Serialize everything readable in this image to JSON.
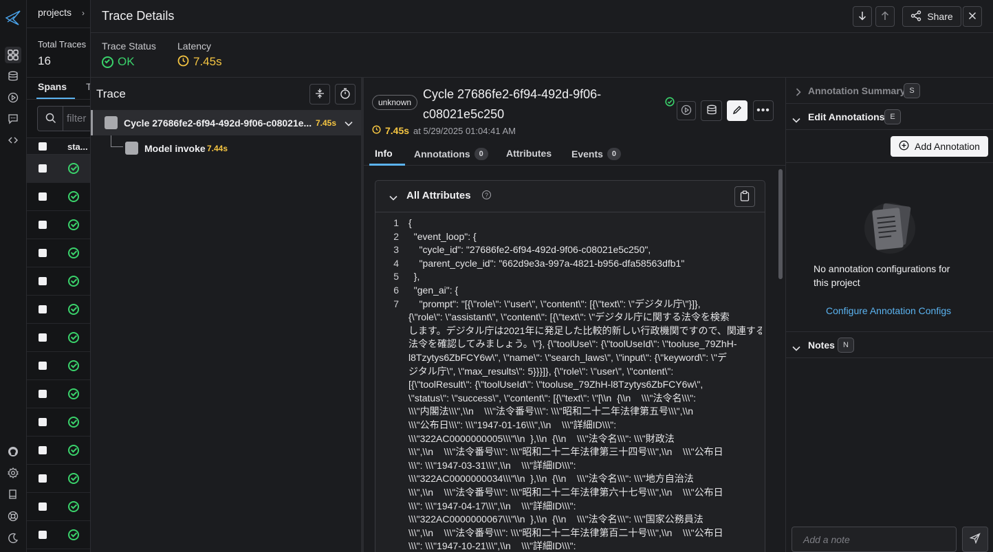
{
  "app": {
    "breadcrumb": "projects",
    "total_traces_label": "Total Traces",
    "total_traces_value": "16",
    "tab_spans": "Spans",
    "tab_partial": "T",
    "filter_placeholder": "filter",
    "status_col": "sta..."
  },
  "header": {
    "title": "Trace Details",
    "share_label": "Share"
  },
  "status": {
    "trace_status_label": "Trace Status",
    "trace_status_value": "OK",
    "latency_label": "Latency",
    "latency_value": "7.45s"
  },
  "trace_panel": {
    "title": "Trace",
    "spans": [
      {
        "name": "Cycle 27686fe2-6f94-492d-9f06-c08021e...",
        "latency": "7.45s"
      },
      {
        "name": "Model invoke",
        "latency": "7.44s"
      }
    ]
  },
  "span": {
    "kind_badge": "unknown",
    "title_line1": "Cycle 27686fe2-6f94-492d-9f06-",
    "title_line2": "c08021e5c250",
    "latency": "7.45s",
    "timestamp": "at 5/29/2025 01:04:41 AM",
    "tabs": [
      {
        "label": "Info",
        "count": null
      },
      {
        "label": "Annotations",
        "count": "0"
      },
      {
        "label": "Attributes",
        "count": null
      },
      {
        "label": "Events",
        "count": "0"
      }
    ],
    "attributes_title": "All Attributes",
    "code_lines": [
      {
        "n": "1",
        "text": "{"
      },
      {
        "n": "2",
        "text": "  \"event_loop\": {"
      },
      {
        "n": "3",
        "text": "    \"cycle_id\": \"27686fe2-6f94-492d-9f06-c08021e5c250\","
      },
      {
        "n": "4",
        "text": "    \"parent_cycle_id\": \"662d9e3a-997a-4821-b956-dfa58563dfb1\""
      },
      {
        "n": "5",
        "text": "  },"
      },
      {
        "n": "6",
        "text": "  \"gen_ai\": {"
      },
      {
        "n": "7",
        "text": "    \"prompt\": \"[{\\\"role\\\": \\\"user\\\", \\\"content\\\": [{\\\"text\\\": \\\"デジタル庁\\\"}]},"
      },
      {
        "n": "",
        "text": "{\\\"role\\\": \\\"assistant\\\", \\\"content\\\": [{\\\"text\\\": \\\"デジタル庁に関する法令を検索"
      },
      {
        "n": "",
        "text": "します。デジタル庁は2021年に発足した比較的新しい行政機関ですので、関連する"
      },
      {
        "n": "",
        "text": "法令を確認してみましょう。\\\"}, {\\\"toolUse\\\": {\\\"toolUseId\\\": \\\"tooluse_79ZhH-"
      },
      {
        "n": "",
        "text": "l8Tzytys6ZbFCY6w\\\", \\\"name\\\": \\\"search_laws\\\", \\\"input\\\": {\\\"keyword\\\": \\\"デ"
      },
      {
        "n": "",
        "text": "ジタル庁\\\", \\\"max_results\\\": 5}}}]}, {\\\"role\\\": \\\"user\\\", \\\"content\\\":"
      },
      {
        "n": "",
        "text": "[{\\\"toolResult\\\": {\\\"toolUseId\\\": \\\"tooluse_79ZhH-l8Tzytys6ZbFCY6w\\\","
      },
      {
        "n": "",
        "text": "\\\"status\\\": \\\"success\\\", \\\"content\\\": [{\\\"text\\\": \\\"[\\\\n  {\\\\n    \\\\\\\"法令名\\\\\\\":"
      },
      {
        "n": "",
        "text": "\\\\\\\"内閣法\\\\\\\",\\\\n    \\\\\\\"法令番号\\\\\\\": \\\\\\\"昭和二十二年法律第五号\\\\\\\",\\\\n"
      },
      {
        "n": "",
        "text": "\\\\\\\"公布日\\\\\\\": \\\\\\\"1947-01-16\\\\\\\",\\\\n    \\\\\\\"詳細ID\\\\\\\":"
      },
      {
        "n": "",
        "text": "\\\\\\\"322AC0000000005\\\\\\\"\\\\n  },\\\\n  {\\\\n    \\\\\\\"法令名\\\\\\\": \\\\\\\"財政法"
      },
      {
        "n": "",
        "text": "\\\\\\\",\\\\n    \\\\\\\"法令番号\\\\\\\": \\\\\\\"昭和二十二年法律第三十四号\\\\\\\",\\\\n    \\\\\\\"公布日"
      },
      {
        "n": "",
        "text": "\\\\\\\": \\\\\\\"1947-03-31\\\\\\\",\\\\n    \\\\\\\"詳細ID\\\\\\\":"
      },
      {
        "n": "",
        "text": "\\\\\\\"322AC0000000034\\\\\\\"\\\\n  },\\\\n  {\\\\n    \\\\\\\"法令名\\\\\\\": \\\\\\\"地方自治法"
      },
      {
        "n": "",
        "text": "\\\\\\\",\\\\n    \\\\\\\"法令番号\\\\\\\": \\\\\\\"昭和二十二年法律第六十七号\\\\\\\",\\\\n    \\\\\\\"公布日"
      },
      {
        "n": "",
        "text": "\\\\\\\": \\\\\\\"1947-04-17\\\\\\\",\\\\n    \\\\\\\"詳細ID\\\\\\\":"
      },
      {
        "n": "",
        "text": "\\\\\\\"322AC0000000067\\\\\\\"\\\\n  },\\\\n  {\\\\n    \\\\\\\"法令名\\\\\\\": \\\\\\\"国家公務員法"
      },
      {
        "n": "",
        "text": "\\\\\\\",\\\\n    \\\\\\\"法令番号\\\\\\\": \\\\\\\"昭和二十二年法律第百二十号\\\\\\\",\\\\n    \\\\\\\"公布日"
      },
      {
        "n": "",
        "text": "\\\\\\\": \\\\\\\"1947-10-21\\\\\\\",\\\\n    \\\\\\\"詳細ID\\\\\\\":"
      }
    ]
  },
  "annotations": {
    "summary_label": "Annotation Summary",
    "summary_key": "S",
    "edit_label": "Edit Annotations",
    "edit_key": "E",
    "add_button": "Add Annotation",
    "empty_message_line1": "No annotation configurations for",
    "empty_message_line2": "this project",
    "configure_link": "Configure Annotation Configs",
    "notes_label": "Notes",
    "notes_key": "N",
    "note_placeholder": "Add a note"
  },
  "colors": {
    "ok_green": "#3ad26b",
    "latency_yellow": "#f5c542",
    "link_blue": "#5bb3f0"
  }
}
